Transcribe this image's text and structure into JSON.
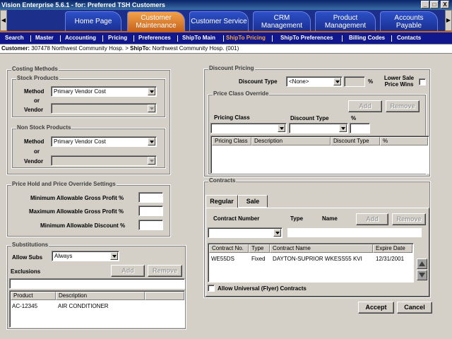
{
  "window": {
    "title": "Vision Enterprise 5.6.1 - for:  Preferred TSH Customers",
    "min": "_",
    "max": "□",
    "close": "X"
  },
  "nav": {
    "left_arrow": "◀",
    "right_arrow": "▶",
    "tabs": [
      "Home Page",
      "Customer Maintenance",
      "Customer Service",
      "CRM Management",
      "Product Management",
      "Accounts Payable"
    ]
  },
  "menu": [
    "Search",
    "Master",
    "Accounting",
    "Pricing",
    "Preferences",
    "ShipTo Main",
    "ShipTo Pricing",
    "ShipTo Preferences",
    "Billing Codes",
    "Contacts"
  ],
  "breadcrumb": {
    "customer_label": "Customer:",
    "customer_value": "307478 Northwest Community Hosp.",
    "sep": ">",
    "shipto_label": "ShipTo:",
    "shipto_value": "Northwest Community Hosp. (001)"
  },
  "costing": {
    "title": "Costing Methods",
    "stock": {
      "title": "Stock Products",
      "method_label": "Method",
      "or": "or",
      "vendor_label": "Vendor",
      "method_value": "Primary Vendor Cost",
      "vendor_value": ""
    },
    "nonstock": {
      "title": "Non Stock Products",
      "method_label": "Method",
      "or": "or",
      "vendor_label": "Vendor",
      "method_value": "Primary Vendor Cost",
      "vendor_value": ""
    }
  },
  "price_hold": {
    "title": "Price Hold and Price Override Settings",
    "min_gp": "Minimum Allowable Gross Profit %",
    "max_gp": "Maximum Allowable Gross Profit %",
    "min_disc": "Minimum Allowable Discount %",
    "min_gp_value": "",
    "max_gp_value": "",
    "min_disc_value": ""
  },
  "subs": {
    "title": "Substitutions",
    "allow_label": "Allow Subs",
    "allow_value": "Always",
    "exclusions_label": "Exclusions",
    "add": "Add",
    "remove": "Remove",
    "columns": [
      "Product",
      "Description"
    ],
    "rows": [
      {
        "product": "AC-12345",
        "description": "AIR CONDITIONER"
      }
    ]
  },
  "discount": {
    "title": "Discount Pricing",
    "type_label": "Discount Type",
    "type_value": "<None>",
    "pct": "%",
    "lower_sale": "Lower Sale Price Wins",
    "override": {
      "title": "Price Class Override",
      "add": "Add",
      "remove": "Remove",
      "pricing_class_label": "Pricing Class",
      "discount_type_label": "Discount Type",
      "pct_label": "%",
      "columns": [
        "Pricing Class",
        "Description",
        "Discount Type",
        "%"
      ]
    }
  },
  "contracts": {
    "title": "Contracts",
    "tabs": [
      "Regular",
      "Sale"
    ],
    "number_label": "Contract Number",
    "type_label": "Type",
    "name_label": "Name",
    "add": "Add",
    "remove": "Remove",
    "columns": [
      "Contract No.",
      "Type",
      "Contract Name",
      "Expire Date"
    ],
    "rows": [
      {
        "no": "WE55DS",
        "type": "Fixed",
        "name": "DAYTON-SUPRIOR WKESS55 KVI",
        "expire": "12/31/2001"
      }
    ],
    "universal_label": "Allow Universal (Flyer) Contracts"
  },
  "actions": {
    "accept": "Accept",
    "cancel": "Cancel"
  }
}
